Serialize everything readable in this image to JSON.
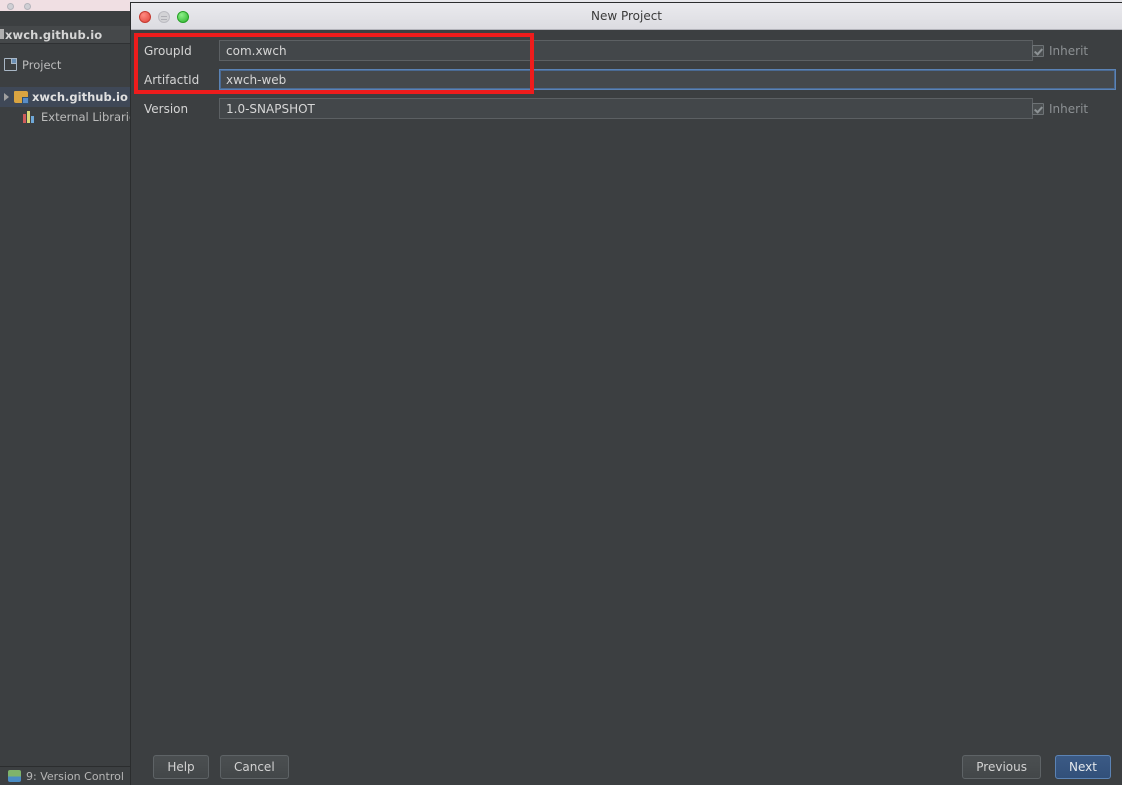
{
  "ide": {
    "sidebar": {
      "project_name": "xwch.github.io",
      "tab_label": "Project",
      "tree": [
        {
          "label": "xwch.github.io",
          "icon": "folder-module-icon",
          "expandable": true
        },
        {
          "label": "External Librarie",
          "icon": "external-libraries-icon",
          "expandable": false
        }
      ],
      "bottom_tool_label": "9: Version Control"
    }
  },
  "dialog": {
    "title": "New Project",
    "window_controls": {
      "close": "close-button",
      "minimize": "minimize-button",
      "maximize": "maximize-button"
    },
    "form": {
      "rows": [
        {
          "label": "GroupId",
          "value": "com.xwch",
          "focused": false,
          "inherit": {
            "label": "Inherit",
            "checked": true,
            "enabled": false
          }
        },
        {
          "label": "ArtifactId",
          "value": "xwch-web",
          "focused": true,
          "inherit": null
        },
        {
          "label": "Version",
          "value": "1.0-SNAPSHOT",
          "focused": false,
          "inherit": {
            "label": "Inherit",
            "checked": true,
            "enabled": false
          }
        }
      ]
    },
    "footer": {
      "help_label": "Help",
      "cancel_label": "Cancel",
      "previous_label": "Previous",
      "next_label": "Next"
    }
  },
  "annotation": {
    "color": "#ee1c1c",
    "shape": "rectangle",
    "targets": [
      "GroupId",
      "ArtifactId"
    ]
  }
}
